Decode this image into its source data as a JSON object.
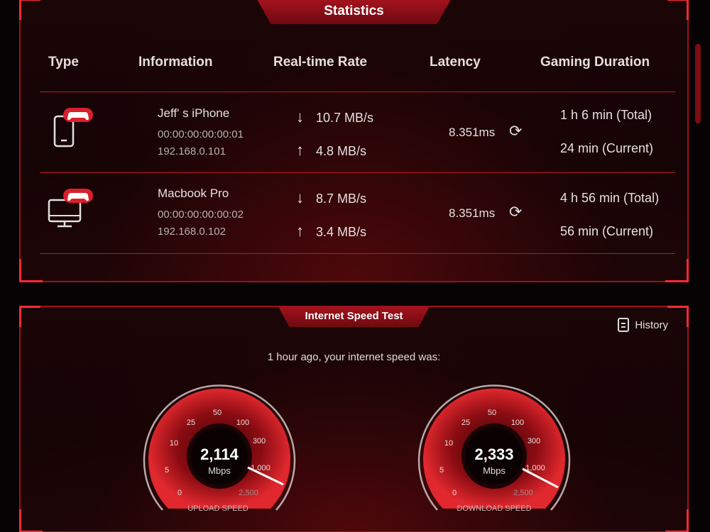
{
  "stats": {
    "title": "Statistics",
    "columns": {
      "type": "Type",
      "information": "Information",
      "rate": "Real-time Rate",
      "latency": "Latency",
      "duration": "Gaming Duration"
    },
    "devices": [
      {
        "icon": "phone-icon",
        "name": "Jeff' s iPhone",
        "mac": "00:00:00:00:00:01",
        "ip": "192.168.0.101",
        "download": "10.7 MB/s",
        "upload": "4.8 MB/s",
        "latency": "8.351ms",
        "total": "1 h 6 min (Total)",
        "current": "24 min (Current)"
      },
      {
        "icon": "monitor-icon",
        "name": "Macbook Pro",
        "mac": "00:00:00:00:00:02",
        "ip": "192.168.0.102",
        "download": "8.7 MB/s",
        "upload": "3.4 MB/s",
        "latency": "8.351ms",
        "total": "4 h 56 min (Total)",
        "current": "56 min (Current)"
      }
    ],
    "arrows": {
      "down": "↓",
      "up": "↑",
      "refresh": "⟳"
    }
  },
  "speed_test": {
    "title": "Internet Speed Test",
    "history_label": "History",
    "caption": "1 hour ago, your internet speed was:",
    "unit": "Mbps",
    "scale_labels": [
      "0",
      "5",
      "10",
      "25",
      "50",
      "100",
      "300",
      "1,000",
      "2,500"
    ],
    "upload": {
      "value": "2,114",
      "label": "UPLOAD SPEED"
    },
    "download": {
      "value": "2,333",
      "label": "DOWNLOAD SPEED"
    }
  },
  "colors": {
    "accent": "#c01820",
    "highlight": "#ff2a36",
    "badge": "#d8202c"
  }
}
